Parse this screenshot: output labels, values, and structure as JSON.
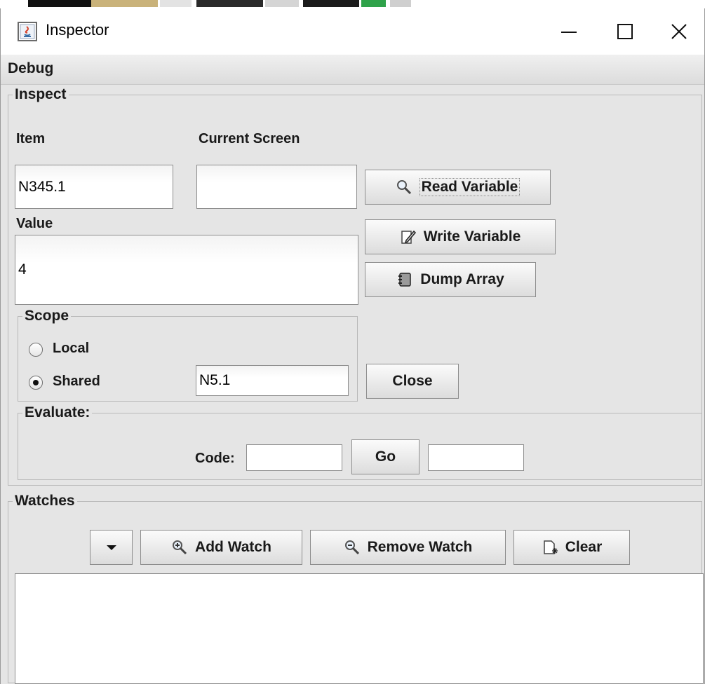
{
  "window": {
    "title": "Inspector",
    "minimize_icon": "minimize-icon",
    "maximize_icon": "maximize-icon",
    "close_icon": "close-icon"
  },
  "menubar": {
    "items": [
      "Debug"
    ]
  },
  "inspect": {
    "legend": "Inspect",
    "item_label": "Item",
    "item_value": "N345.1",
    "current_screen_label": "Current Screen",
    "current_screen_value": "",
    "value_label": "Value",
    "value_value": "4",
    "read_variable_label": "Read Variable",
    "write_variable_label": "Write Variable",
    "dump_array_label": "Dump Array",
    "close_label": "Close",
    "scope": {
      "legend": "Scope",
      "local_label": "Local",
      "shared_label": "Shared",
      "selected": "Shared",
      "shared_value": "N5.1"
    },
    "evaluate": {
      "legend": "Evaluate:",
      "code_label": "Code:",
      "code_value": "",
      "go_label": "Go",
      "result_value": ""
    }
  },
  "watches": {
    "legend": "Watches",
    "add_watch_label": "Add Watch",
    "remove_watch_label": "Remove Watch",
    "clear_label": "Clear",
    "items": []
  },
  "colors": {
    "panel_bg": "#e5e5e5",
    "border": "#8e8e8e",
    "text": "#1a1a1a"
  }
}
